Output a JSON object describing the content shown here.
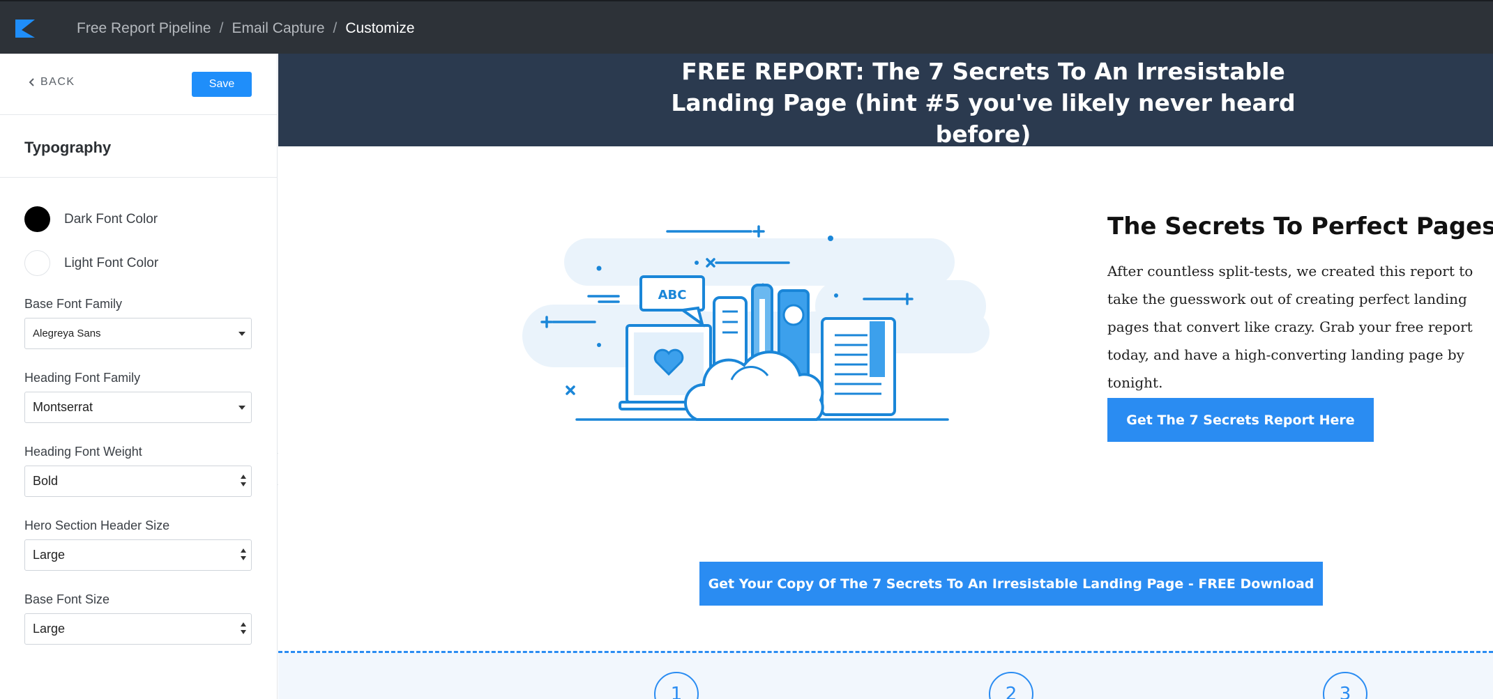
{
  "breadcrumb": {
    "items": [
      "Free Report Pipeline",
      "Email Capture",
      "Customize"
    ],
    "separator": "/"
  },
  "sidebar": {
    "back_label": "BACK",
    "save_label": "Save",
    "section_title": "Typography",
    "colors": [
      {
        "label": "Dark Font Color",
        "value": "#000000"
      },
      {
        "label": "Light Font Color",
        "value": "#ffffff"
      }
    ],
    "fields": {
      "base_font_family": {
        "label": "Base Font Family",
        "value": "Alegreya Sans"
      },
      "heading_font_family": {
        "label": "Heading Font Family",
        "value": "Montserrat"
      },
      "heading_font_weight": {
        "label": "Heading Font Weight",
        "value": "Bold"
      },
      "hero_header_size": {
        "label": "Hero Section Header Size",
        "value": "Large"
      },
      "base_font_size": {
        "label": "Base Font Size",
        "value": "Large"
      }
    }
  },
  "preview": {
    "hero_title": "FREE REPORT: The 7 Secrets To An Irresistable Landing Page (hint #5 you've likely never heard before)",
    "illustration_text": "ABC",
    "content_title": "The Secrets To Perfect Pages",
    "content_body": "After countless split-tests, we created this report to take the guesswork out of creating perfect landing pages that convert like crazy. Grab your free report today, and have a high-converting landing page by tonight.",
    "cta_primary": "Get The 7 Secrets Report Here",
    "cta_secondary": "Get Your Copy Of The 7 Secrets To An Irresistable Landing Page - FREE Download",
    "steps": [
      "1",
      "2",
      "3"
    ]
  },
  "colors": {
    "topbar": "#2d3238",
    "accent": "#1f8efa",
    "hero_band": "#2b3a4f",
    "cta": "#2a8cf2"
  },
  "icons": [
    "brand-logo-icon",
    "chevron-left-icon",
    "caret-down-icon",
    "updown-caret-icon",
    "collapse-left-icon"
  ]
}
